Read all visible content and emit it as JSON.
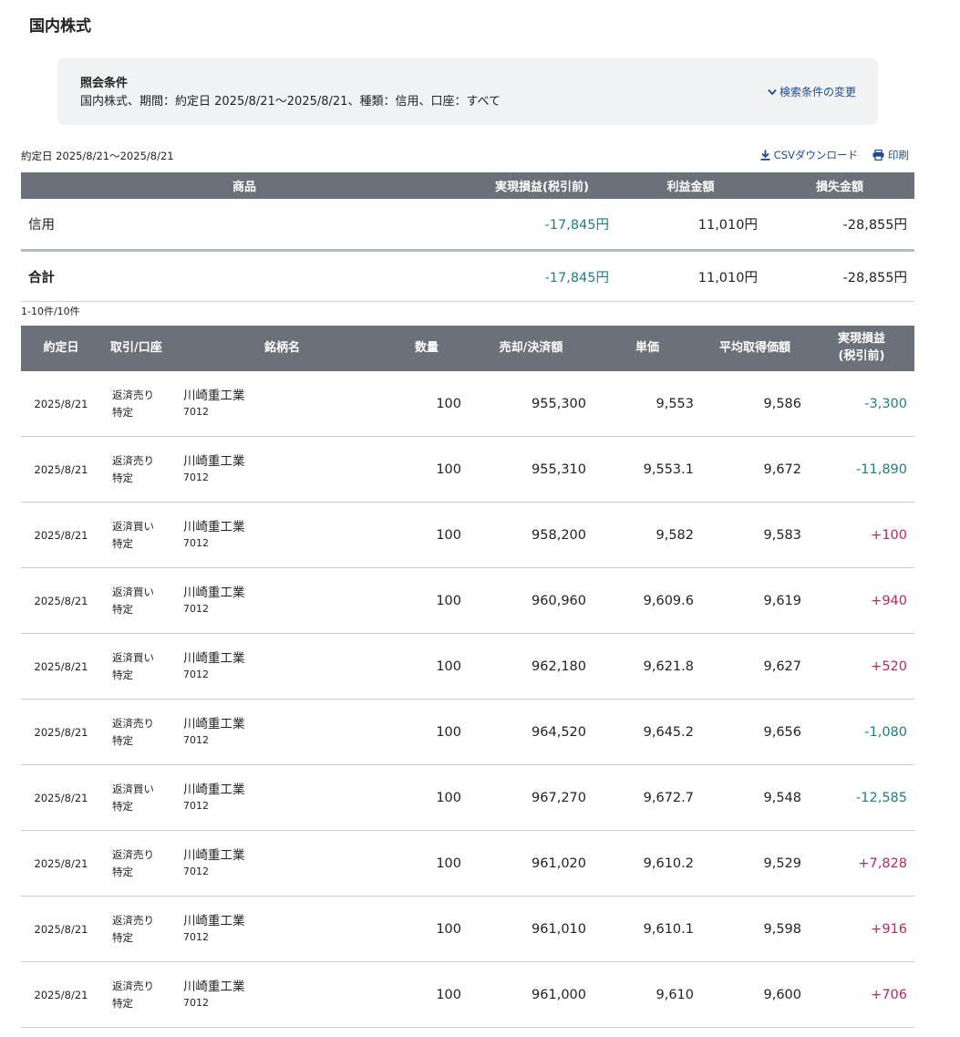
{
  "page": {
    "title": "国内株式"
  },
  "conditions": {
    "title": "照会条件",
    "text": "国内株式、期間：約定日 2025/8/21〜2025/8/21、種類：信用、口座：すべて",
    "change_label": "検索条件の変更"
  },
  "period": "約定日 2025/8/21〜2025/8/21",
  "actions": {
    "csv_label": "CSVダウンロード",
    "print_label": "印刷"
  },
  "summary": {
    "headers": {
      "product": "商品",
      "realized": "実現損益(税引前)",
      "profit": "利益金額",
      "loss": "損失金額"
    },
    "rows": [
      {
        "product": "信用",
        "realized": "-17,845円",
        "profit": "11,010円",
        "loss": "-28,855円"
      }
    ],
    "total": {
      "label": "合計",
      "realized": "-17,845円",
      "profit": "11,010円",
      "loss": "-28,855円"
    }
  },
  "count_text": "1-10件/10件",
  "detail": {
    "headers": {
      "date": "約定日",
      "trade": "取引/口座",
      "name": "銘柄名",
      "qty": "数量",
      "amount": "売却/決済額",
      "price": "単価",
      "avg": "平均取得価額",
      "pl_line1": "実現損益",
      "pl_line2": "(税引前)"
    },
    "rows": [
      {
        "date": "2025/8/21",
        "trade": "返済売り",
        "account": "特定",
        "name": "川崎重工業",
        "code": "7012",
        "qty": "100",
        "amount": "955,300",
        "price": "9,553",
        "avg": "9,586",
        "pl": "-3,300"
      },
      {
        "date": "2025/8/21",
        "trade": "返済売り",
        "account": "特定",
        "name": "川崎重工業",
        "code": "7012",
        "qty": "100",
        "amount": "955,310",
        "price": "9,553.1",
        "avg": "9,672",
        "pl": "-11,890"
      },
      {
        "date": "2025/8/21",
        "trade": "返済買い",
        "account": "特定",
        "name": "川崎重工業",
        "code": "7012",
        "qty": "100",
        "amount": "958,200",
        "price": "9,582",
        "avg": "9,583",
        "pl": "+100"
      },
      {
        "date": "2025/8/21",
        "trade": "返済買い",
        "account": "特定",
        "name": "川崎重工業",
        "code": "7012",
        "qty": "100",
        "amount": "960,960",
        "price": "9,609.6",
        "avg": "9,619",
        "pl": "+940"
      },
      {
        "date": "2025/8/21",
        "trade": "返済買い",
        "account": "特定",
        "name": "川崎重工業",
        "code": "7012",
        "qty": "100",
        "amount": "962,180",
        "price": "9,621.8",
        "avg": "9,627",
        "pl": "+520"
      },
      {
        "date": "2025/8/21",
        "trade": "返済売り",
        "account": "特定",
        "name": "川崎重工業",
        "code": "7012",
        "qty": "100",
        "amount": "964,520",
        "price": "9,645.2",
        "avg": "9,656",
        "pl": "-1,080"
      },
      {
        "date": "2025/8/21",
        "trade": "返済買い",
        "account": "特定",
        "name": "川崎重工業",
        "code": "7012",
        "qty": "100",
        "amount": "967,270",
        "price": "9,672.7",
        "avg": "9,548",
        "pl": "-12,585"
      },
      {
        "date": "2025/8/21",
        "trade": "返済売り",
        "account": "特定",
        "name": "川崎重工業",
        "code": "7012",
        "qty": "100",
        "amount": "961,020",
        "price": "9,610.2",
        "avg": "9,529",
        "pl": "+7,828"
      },
      {
        "date": "2025/8/21",
        "trade": "返済売り",
        "account": "特定",
        "name": "川崎重工業",
        "code": "7012",
        "qty": "100",
        "amount": "961,010",
        "price": "9,610.1",
        "avg": "9,598",
        "pl": "+916"
      },
      {
        "date": "2025/8/21",
        "trade": "返済売り",
        "account": "特定",
        "name": "川崎重工業",
        "code": "7012",
        "qty": "100",
        "amount": "961,000",
        "price": "9,610",
        "avg": "9,600",
        "pl": "+706"
      }
    ]
  },
  "colors": {
    "negative": "#1f7e84",
    "positive": "#c0255b",
    "header_bg": "#6b7079",
    "link": "#1e4b8f"
  },
  "icons": {
    "change": "chevron-down-icon",
    "csv": "download-icon",
    "print": "printer-icon"
  }
}
